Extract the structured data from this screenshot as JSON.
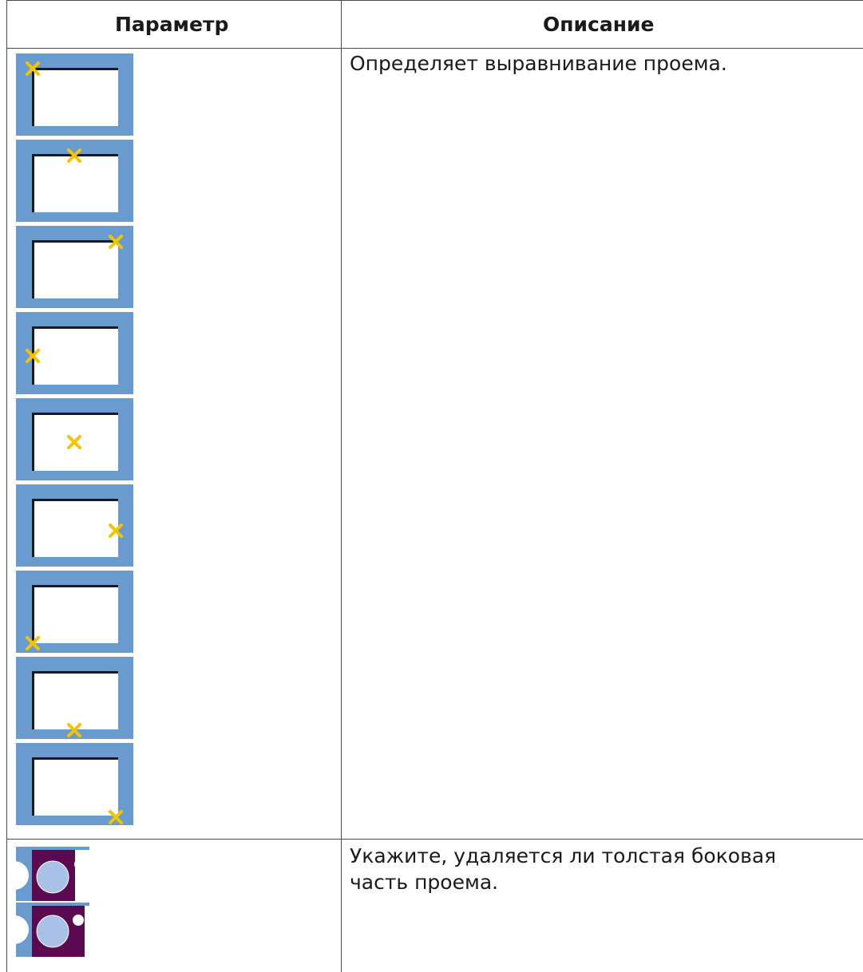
{
  "table": {
    "headers": {
      "param": "Параметр",
      "desc": "Описание"
    },
    "rows": [
      {
        "description": "Определяет выравнивание проема.",
        "icons": [
          "align-top-left-icon",
          "align-top-center-icon",
          "align-top-right-icon",
          "align-middle-left-icon",
          "align-center-icon",
          "align-middle-right-icon",
          "align-bottom-left-icon",
          "align-bottom-center-icon",
          "align-bottom-right-icon"
        ]
      },
      {
        "description_line1": "Укажите, удаляется ли толстая боковая",
        "description_line2": "часть проема.",
        "icons": [
          "thick-side-removed-icon",
          "thick-side-kept-icon"
        ]
      }
    ]
  },
  "colors": {
    "tile_blue": "#6a9bce",
    "marker_yellow": "#f5c400",
    "purple": "#5b0a52"
  }
}
